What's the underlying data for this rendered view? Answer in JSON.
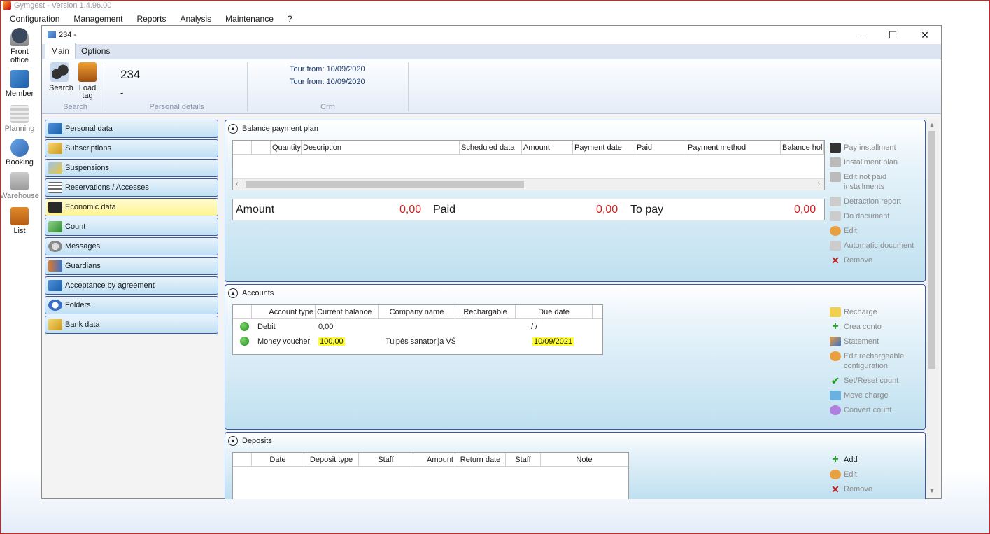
{
  "app": {
    "title": "Gymgest - Version 1.4.96.00"
  },
  "menu": [
    "Configuration",
    "Management",
    "Reports",
    "Analysis",
    "Maintenance",
    "?"
  ],
  "launcher": [
    {
      "label": "Front office",
      "icon": "monitor-icon"
    },
    {
      "label": "Member",
      "icon": "member-card-icon"
    },
    {
      "label": "Planning",
      "icon": "calendar-icon"
    },
    {
      "label": "Booking",
      "icon": "booking-globe-icon"
    },
    {
      "label": "Warehouse",
      "icon": "warehouse-icon"
    },
    {
      "label": "List",
      "icon": "list-briefcase-icon"
    }
  ],
  "window": {
    "title": "234 -",
    "controls": [
      "–",
      "☐",
      "✕"
    ]
  },
  "tabs": [
    "Main",
    "Options"
  ],
  "ribbon": {
    "search_label": "Search",
    "loadtag_label": "Load tag",
    "group_search": "Search",
    "group_personal": "Personal details",
    "group_crm": "Crm",
    "member_id": "234",
    "member_sub": "-",
    "crm_lines": [
      "Tour from: 10/09/2020",
      "Tour from: 10/09/2020"
    ]
  },
  "sidenav": [
    {
      "label": "Personal data",
      "icon": "id-card-icon"
    },
    {
      "label": "Subscriptions",
      "icon": "ticket-icon"
    },
    {
      "label": "Suspensions",
      "icon": "suspension-icon"
    },
    {
      "label": "Reservations / Accesses",
      "icon": "reservation-list-icon"
    },
    {
      "label": "Economic data",
      "icon": "wallet-icon"
    },
    {
      "label": "Count",
      "icon": "money-stack-icon"
    },
    {
      "label": "Messages",
      "icon": "message-icon"
    },
    {
      "label": "Guardians",
      "icon": "guardians-icon"
    },
    {
      "label": "Acceptance by agreement",
      "icon": "agreement-icon"
    },
    {
      "label": "Folders",
      "icon": "folder-icon"
    },
    {
      "label": "Bank data",
      "icon": "bank-icon"
    }
  ],
  "balance": {
    "title": "Balance payment plan",
    "columns": [
      "",
      "",
      "Quantity",
      "Description",
      "Scheduled data",
      "Amount",
      "Payment date",
      "Paid",
      "Payment method",
      "Balance hold"
    ],
    "amount_label": "Amount",
    "amount_value": "0,00",
    "paid_label": "Paid",
    "paid_value": "0,00",
    "topay_label": "To pay",
    "topay_value": "0,00",
    "actions": [
      "Pay installment",
      "Installment plan",
      "Edit not paid installments",
      "Detraction report",
      "Do document",
      "Edit",
      "Automatic document",
      "Remove"
    ]
  },
  "accounts": {
    "title": "Accounts",
    "columns": [
      "",
      "Account type",
      "Current balance",
      "Company name",
      "Rechargable",
      "Due date"
    ],
    "rows": [
      {
        "type": "Debit",
        "balance": "0,00",
        "company": "",
        "rechargable": "",
        "due": "/ /"
      },
      {
        "type": "Money voucher",
        "balance": "100,00",
        "company": "Tulpės sanatorija VŠĮ",
        "rechargable": "",
        "due": "10/09/2021"
      }
    ],
    "actions": [
      "Recharge",
      "Crea conto",
      "Statement",
      "Edit rechargeable configuration",
      "Set/Reset count",
      "Move charge",
      "Convert count"
    ]
  },
  "deposits": {
    "title": "Deposits",
    "columns": [
      "",
      "Date",
      "Deposit type",
      "Staff",
      "Amount",
      "Return date",
      "Staff",
      "Note"
    ],
    "actions": [
      "Add",
      "Edit",
      "Remove"
    ]
  }
}
